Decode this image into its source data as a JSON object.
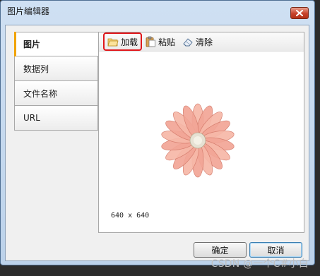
{
  "window": {
    "title": "图片编辑器"
  },
  "tabs": [
    {
      "label": "图片",
      "active": true
    },
    {
      "label": "数据列",
      "active": false
    },
    {
      "label": "文件名称",
      "active": false
    },
    {
      "label": "URL",
      "active": false
    }
  ],
  "toolbar": {
    "load": {
      "label": "加载",
      "icon": "folder-open-icon"
    },
    "paste": {
      "label": "粘贴",
      "icon": "clipboard-icon"
    },
    "clear": {
      "label": "清除",
      "icon": "eraser-icon"
    }
  },
  "preview": {
    "size_text": "640 x 640"
  },
  "buttons": {
    "ok": "确定",
    "cancel": "取消"
  },
  "watermark": "CSDN @一个C#小白",
  "colors": {
    "highlight": "#e0161a",
    "active_tab_accent": "#f1a300"
  }
}
